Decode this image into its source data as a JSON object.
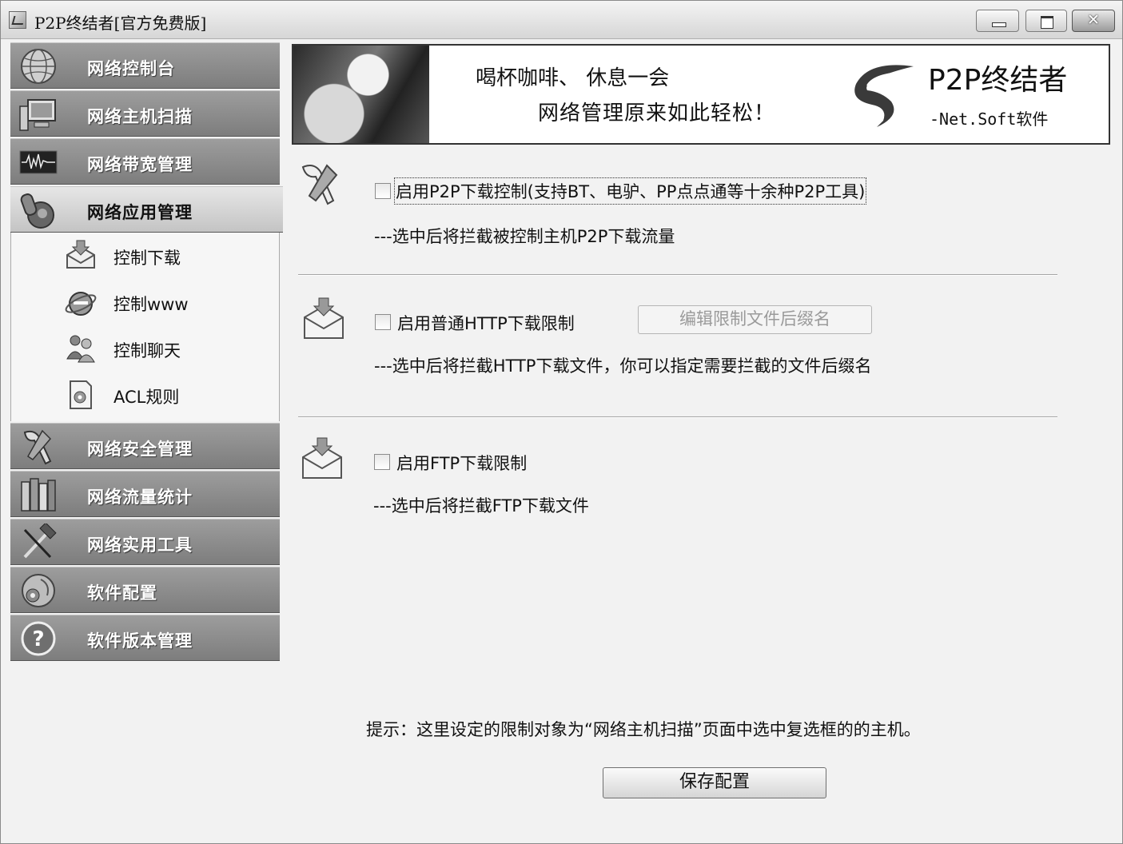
{
  "window": {
    "title": "P2P终结者[官方免费版]",
    "close_glyph": "✕"
  },
  "sidebar": {
    "nav_top": [
      {
        "label": "网络控制台",
        "icon": "globe-icon"
      },
      {
        "label": "网络主机扫描",
        "icon": "computer-icon"
      },
      {
        "label": "网络带宽管理",
        "icon": "waveform-icon"
      },
      {
        "label": "网络应用管理",
        "icon": "app-manage-icon"
      }
    ],
    "sub_items": [
      {
        "label": "控制下载",
        "icon": "download-envelope-icon"
      },
      {
        "label": "控制www",
        "icon": "ie-icon"
      },
      {
        "label": "控制聊天",
        "icon": "chat-users-icon"
      },
      {
        "label": "ACL规则",
        "icon": "acl-rules-icon"
      }
    ],
    "nav_bottom": [
      {
        "label": "网络安全管理",
        "icon": "tools-icon"
      },
      {
        "label": "网络流量统计",
        "icon": "books-icon"
      },
      {
        "label": "网络实用工具",
        "icon": "hammer-icon"
      },
      {
        "label": "软件配置",
        "icon": "config-globe-icon"
      },
      {
        "label": "软件版本管理",
        "icon": "help-icon"
      }
    ]
  },
  "banner": {
    "line1": "喝杯咖啡、  休息一会",
    "line2": "网络管理原来如此轻松！",
    "brand_name": "P2P终结者",
    "brand_sub": "-Net.Soft软件"
  },
  "sections": {
    "p2p": {
      "label": "启用P2P下载控制(支持BT、电驴、PP点点通等十余种P2P工具)",
      "desc": "---选中后将拦截被控制主机P2P下载流量",
      "checked": false
    },
    "http": {
      "label": "启用普通HTTP下载限制",
      "desc": "---选中后将拦截HTTP下载文件，你可以指定需要拦截的文件后缀名",
      "edit_button": "编辑限制文件后缀名",
      "checked": false
    },
    "ftp": {
      "label": "启用FTP下载限制",
      "desc": "---选中后将拦截FTP下载文件",
      "checked": false
    }
  },
  "footer": {
    "tip": "提示：这里设定的限制对象为“网络主机扫描”页面中选中复选框的的主机。",
    "save_label": "保存配置"
  }
}
